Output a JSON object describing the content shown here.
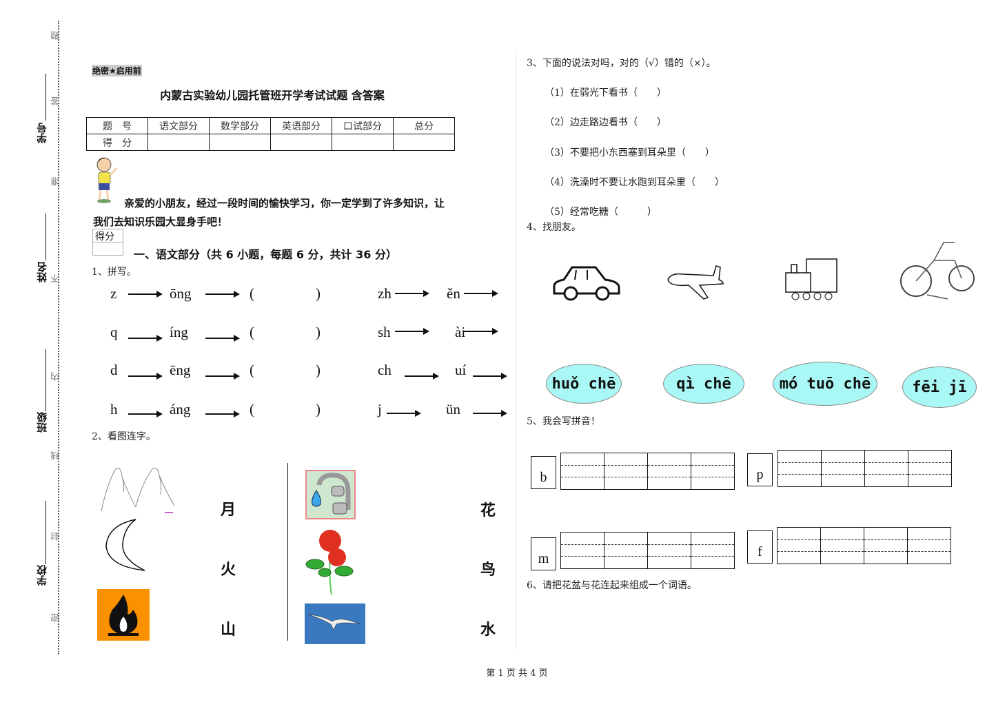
{
  "binding_margin": {
    "fields": [
      "学号",
      "姓名",
      "班级",
      "学校"
    ],
    "seal_chars": [
      "题",
      "答",
      "准",
      "不",
      "内",
      "线",
      "封",
      "密"
    ]
  },
  "header": {
    "secret_label": "绝密★启用前",
    "title": "内蒙古实验幼儿园托管班开学考试试题 含答案"
  },
  "score_table": {
    "row1": [
      "题　号",
      "语文部分",
      "数学部分",
      "英语部分",
      "口试部分",
      "总分"
    ],
    "row2_label": "得　分"
  },
  "intro": {
    "line1": "亲爱的小朋友，经过一段时间的愉快学习，你一定学到了许多知识，让",
    "line2": "我们去知识乐园大显身手吧！"
  },
  "score_box_label": "得分",
  "section1_title": "一、语文部分（共 6 小题，每题 6 分，共计 36 分）",
  "q1": {
    "label": "1、拼写。",
    "left_rows": [
      {
        "initial": "z",
        "final": "ōng",
        "open": "(",
        "close": ")"
      },
      {
        "initial": "q",
        "final": "íng",
        "open": "(",
        "close": ")"
      },
      {
        "initial": "d",
        "final": "ēng",
        "open": "(",
        "close": ")"
      },
      {
        "initial": "h",
        "final": "áng",
        "open": "(",
        "close": ")"
      }
    ],
    "right_rows": [
      {
        "initial": "zh",
        "final": "ěn"
      },
      {
        "initial": "sh",
        "final": "ài"
      },
      {
        "initial": "ch",
        "final": "uí"
      },
      {
        "initial": "j",
        "final": "ün"
      }
    ]
  },
  "q2": {
    "label": "2、看图连字。",
    "left_pictures": [
      "mountain-image",
      "moon-image",
      "fire-image"
    ],
    "left_chars": [
      "月",
      "火",
      "山"
    ],
    "right_pictures": [
      "faucet-water-image",
      "rose-flower-image",
      "bird-image"
    ],
    "right_chars": [
      "花",
      "鸟",
      "水"
    ]
  },
  "q3": {
    "label": "3、下面的说法对吗，对的（√）错的（×）。",
    "items": [
      "（1）在弱光下看书（　　）",
      "（2）边走路边看书（　　）",
      "（3）不要把小东西塞到耳朵里（　　）",
      "（4）洗澡时不要让水跑到耳朵里（　　）",
      "（5）经常吃糖（　　　）"
    ]
  },
  "q4": {
    "label": "4、找朋友。",
    "pictures": [
      "car-image",
      "airplane-image",
      "train-image",
      "motorcycle-image"
    ],
    "bubbles": [
      "huǒ chē",
      "qì chē",
      "mó tuō chē",
      "fēi jī"
    ]
  },
  "q5": {
    "label": "5、我会写拼音！",
    "letters": [
      "b",
      "p",
      "m",
      "f"
    ]
  },
  "q6": {
    "label": "6、请把花盆与花连起来组成一个词语。"
  },
  "footer": {
    "page_text": "第 1 页 共 4 页"
  }
}
